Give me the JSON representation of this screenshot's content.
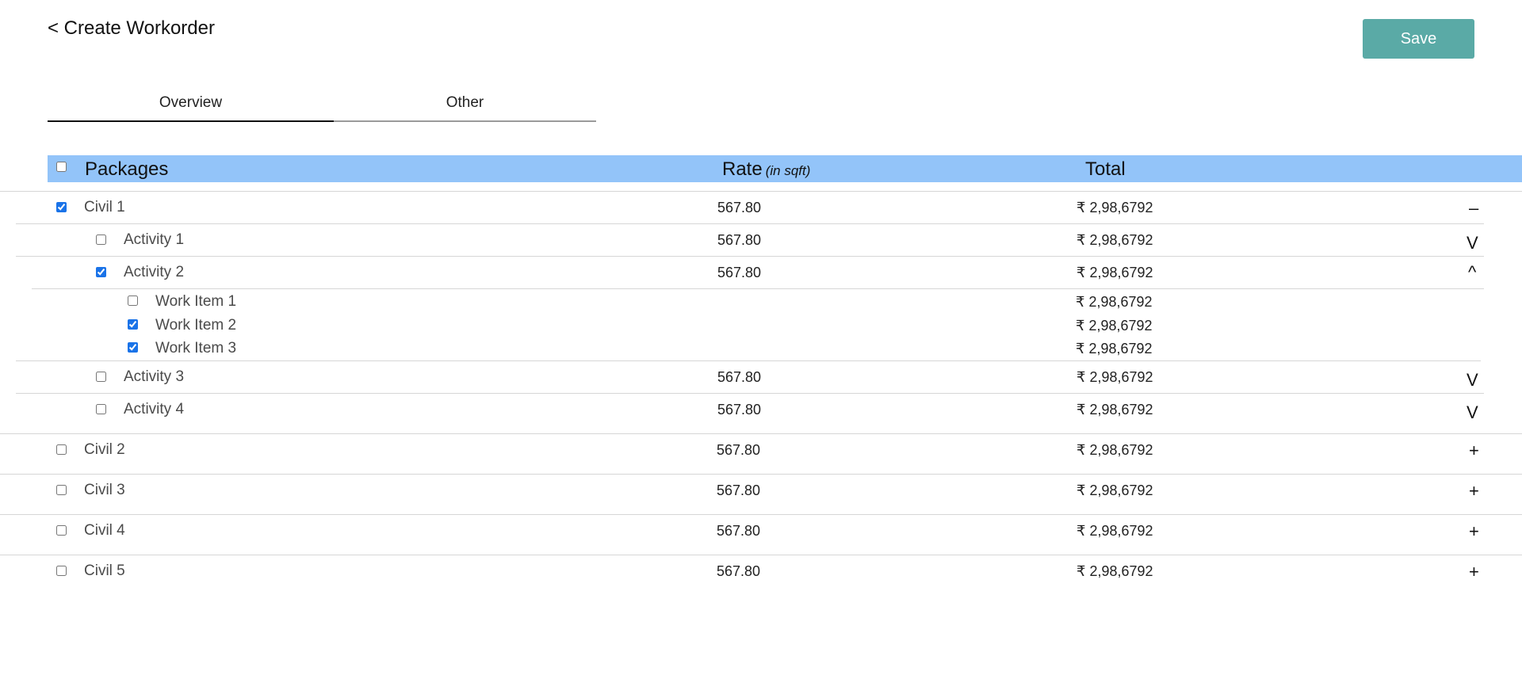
{
  "header": {
    "title": "< Create Workorder",
    "save_label": "Save"
  },
  "tabs": [
    {
      "label": "Overview",
      "active": true
    },
    {
      "label": "Other",
      "active": false
    }
  ],
  "table": {
    "col_packages": "Packages",
    "col_rate": "Rate",
    "col_rate_unit": "(in sqft)",
    "col_total": "Total",
    "select_all_checked": false
  },
  "civil1": {
    "label": "Civil 1",
    "rate": "567.80",
    "total": "₹ 2,98,6792",
    "toggle": "–",
    "checked": true,
    "activities": [
      {
        "label": "Activity 1",
        "rate": "567.80",
        "total": "₹ 2,98,6792",
        "toggle": "V",
        "checked": false
      },
      {
        "label": "Activity 2",
        "rate": "567.80",
        "total": "₹ 2,98,6792",
        "toggle": "^",
        "checked": true,
        "work_items": [
          {
            "label": "Work Item 1",
            "total": "₹ 2,98,6792",
            "checked": false
          },
          {
            "label": "Work Item 2",
            "total": "₹ 2,98,6792",
            "checked": true
          },
          {
            "label": "Work Item 3",
            "total": "₹ 2,98,6792",
            "checked": true
          }
        ]
      },
      {
        "label": "Activity 3",
        "rate": "567.80",
        "total": "₹ 2,98,6792",
        "toggle": "V",
        "checked": false
      },
      {
        "label": "Activity 4",
        "rate": "567.80",
        "total": "₹ 2,98,6792",
        "toggle": "V",
        "checked": false
      }
    ]
  },
  "packages": [
    {
      "label": "Civil 2",
      "rate": "567.80",
      "total": "₹ 2,98,6792",
      "toggle": "+",
      "checked": false
    },
    {
      "label": "Civil 3",
      "rate": "567.80",
      "total": "₹ 2,98,6792",
      "toggle": "+",
      "checked": false
    },
    {
      "label": "Civil 4",
      "rate": "567.80",
      "total": "₹ 2,98,6792",
      "toggle": "+",
      "checked": false
    },
    {
      "label": "Civil 5",
      "rate": "567.80",
      "total": "₹ 2,98,6792",
      "toggle": "+",
      "checked": false
    }
  ]
}
